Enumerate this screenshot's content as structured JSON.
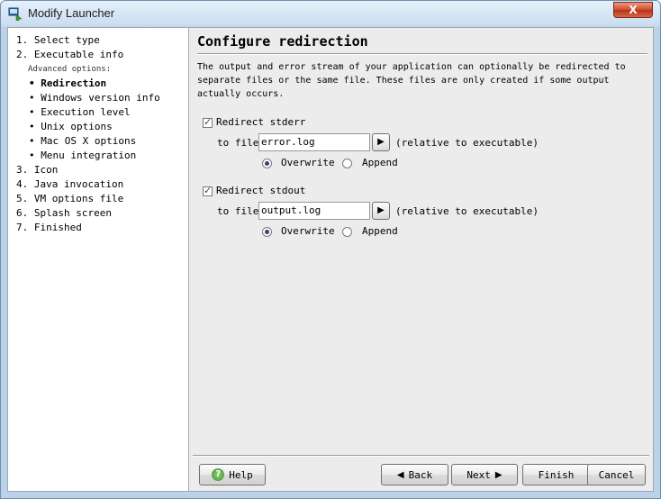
{
  "window": {
    "title": "Modify Launcher",
    "close_label": "X"
  },
  "sidebar": {
    "steps": [
      {
        "label": "1.  Select type"
      },
      {
        "label": "2.  Executable info"
      },
      {
        "label": "Advanced options:"
      },
      {
        "label": "•  Redirection"
      },
      {
        "label": "•  Windows version info"
      },
      {
        "label": "•  Execution level"
      },
      {
        "label": "•  Unix options"
      },
      {
        "label": "•  Mac OS X options"
      },
      {
        "label": "•  Menu integration"
      },
      {
        "label": "3.  Icon"
      },
      {
        "label": "4.  Java invocation"
      },
      {
        "label": "5.  VM options file"
      },
      {
        "label": "6.  Splash screen"
      },
      {
        "label": "7.  Finished"
      }
    ]
  },
  "main": {
    "heading": "Configure redirection",
    "description": [
      "The output and error stream of your application can optionally be redirected to",
      "separate files or the same file. These files are only created if some output",
      "actually occurs."
    ],
    "stderr": {
      "checkbox_label": "Redirect stderr",
      "file_label": "to file",
      "file_value": "error.log",
      "hint": "(relative to executable)",
      "overwrite_label": "Overwrite",
      "append_label": "Append"
    },
    "stdout": {
      "checkbox_label": "Redirect stdout",
      "file_label": "to file",
      "file_value": "output.log",
      "hint": "(relative to executable)",
      "overwrite_label": "Overwrite",
      "append_label": "Append"
    }
  },
  "buttons": {
    "help": "Help",
    "back": "Back",
    "next": "Next",
    "finish": "Finish",
    "cancel": "Cancel"
  },
  "icons": {
    "app": "launcher-icon",
    "help": "help-icon",
    "back": "arrow-left-icon",
    "next": "arrow-right-icon",
    "chooser": "arrow-right-icon"
  }
}
